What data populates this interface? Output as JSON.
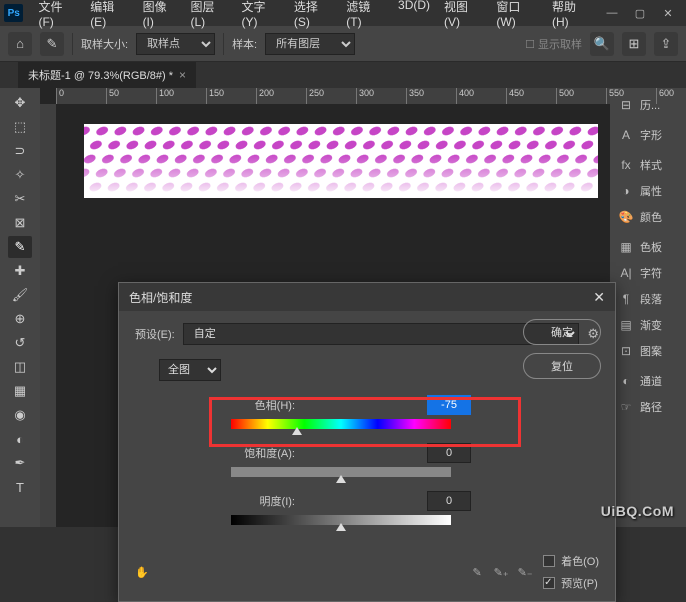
{
  "menu": [
    "文件(F)",
    "编辑(E)",
    "图像(I)",
    "图层(L)",
    "文字(Y)",
    "选择(S)",
    "滤镜(T)",
    "3D(D)",
    "视图(V)",
    "窗口(W)",
    "帮助(H)"
  ],
  "options": {
    "sample_size_label": "取样大小:",
    "sample_size_value": "取样点",
    "sample_label": "样本:",
    "sample_value": "所有图层",
    "show_sample": "显示取样"
  },
  "doc_tab": "未标题-1 @ 79.3%(RGB/8#) *",
  "ruler_marks": [
    "0",
    "50",
    "100",
    "150",
    "200",
    "250",
    "300",
    "350",
    "400",
    "450",
    "500",
    "550",
    "600"
  ],
  "panels": [
    {
      "icon": "⊟",
      "label": "历..."
    },
    {
      "icon": "A",
      "label": "字形"
    },
    {
      "icon": "fx",
      "label": "样式"
    },
    {
      "icon": "◑",
      "label": "属性"
    },
    {
      "icon": "🎨",
      "label": "颜色"
    },
    {
      "icon": "▦",
      "label": "色板"
    },
    {
      "icon": "A|",
      "label": "字符"
    },
    {
      "icon": "¶",
      "label": "段落"
    },
    {
      "icon": "▤",
      "label": "渐变"
    },
    {
      "icon": "⊡",
      "label": "图案"
    },
    {
      "icon": "◐",
      "label": "通道"
    },
    {
      "icon": "☞",
      "label": "路径"
    }
  ],
  "dialog": {
    "title": "色相/饱和度",
    "preset_label": "预设(E):",
    "preset_value": "自定",
    "range_value": "全图",
    "hue_label": "色相(H):",
    "hue_value": "-75",
    "sat_label": "饱和度(A):",
    "sat_value": "0",
    "light_label": "明度(I):",
    "light_value": "0",
    "ok": "确定",
    "reset": "复位",
    "colorize": "着色(O)",
    "preview": "预览(P)"
  },
  "watermark": "UiBQ.CoM"
}
